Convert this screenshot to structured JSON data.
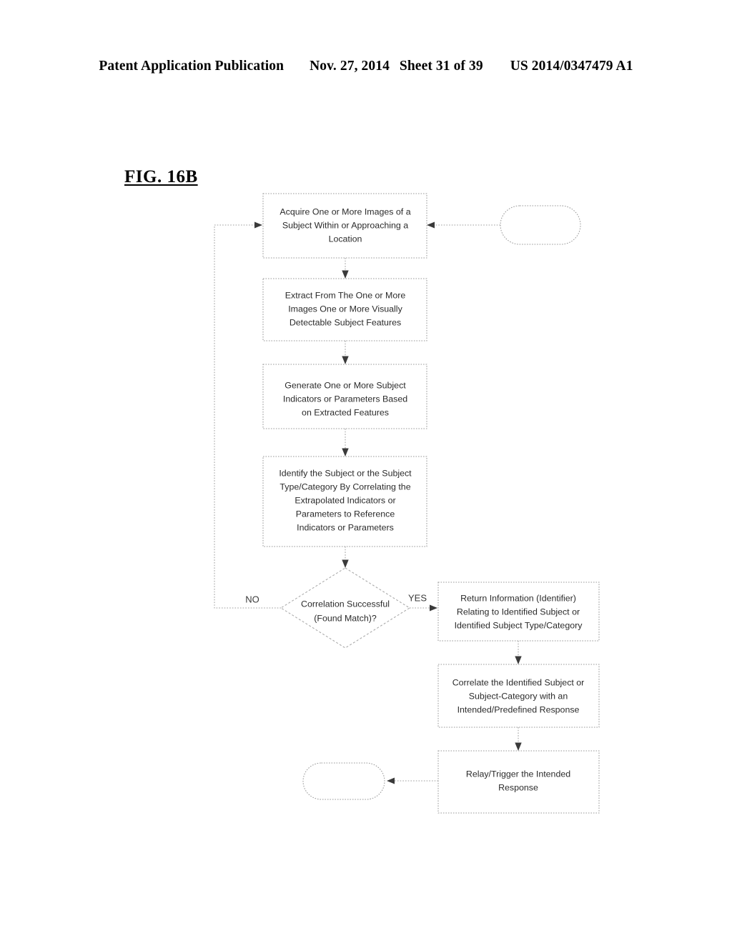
{
  "header": {
    "publication": "Patent Application Publication",
    "date": "Nov. 27, 2014",
    "sheet": "Sheet 31 of 39",
    "pub_number": "US 2014/0347479 A1"
  },
  "figure": {
    "label": "FIG. 16B"
  },
  "flowchart": {
    "nodes": {
      "start_terminator": {
        "text": ""
      },
      "acquire_images": {
        "text": "Acquire One or More Images of a Subject Within or Approaching a Location"
      },
      "extract_features": {
        "text": "Extract From The One or More Images One or More Visually Detectable Subject Features"
      },
      "generate_indicators": {
        "text": "Generate One or More Subject Indicators or Parameters Based on Extracted Features"
      },
      "identify_subject": {
        "text": "Identify the Subject or the Subject Type/Category By Correlating the Extrapolated Indicators or Parameters to Reference Indicators or Parameters"
      },
      "decision": {
        "text": "Correlation Successful (Found Match)?"
      },
      "return_information": {
        "text": "Return Information (Identifier) Relating to Identified Subject or Identified Subject Type/Category"
      },
      "correlate_response": {
        "text": "Correlate the Identified Subject or Subject-Category with an Intended/Predefined Response"
      },
      "relay_trigger": {
        "text": "Relay/Trigger the Intended Response"
      },
      "end_terminator": {
        "text": ""
      }
    },
    "node_lines": {
      "acquire_images": [
        "Acquire One or More Images of a",
        "Subject Within or Approaching a",
        "Location"
      ],
      "extract_features": [
        "Extract From The One or More",
        "Images One or More Visually",
        "Detectable Subject Features"
      ],
      "generate_indicators": [
        "Generate One or More Subject",
        "Indicators or Parameters Based",
        "on Extracted Features"
      ],
      "identify_subject": [
        "Identify the Subject or the Subject",
        "Type/Category By Correlating the",
        "Extrapolated Indicators or",
        "Parameters to Reference",
        "Indicators or Parameters"
      ],
      "decision": [
        "Correlation Successful",
        "(Found Match)?"
      ],
      "return_information": [
        "Return Information (Identifier)",
        "Relating to Identified Subject or",
        "Identified Subject Type/Category"
      ],
      "correlate_response": [
        "Correlate the Identified Subject or",
        "Subject-Category with an",
        "Intended/Predefined Response"
      ],
      "relay_trigger": [
        "Relay/Trigger the Intended",
        "Response"
      ]
    },
    "branch_labels": {
      "no": "NO",
      "yes": "YES"
    },
    "colors": {
      "line": "#9d9d9d",
      "text": "#2b2b2b",
      "arrow": "#3a3a3a"
    }
  }
}
